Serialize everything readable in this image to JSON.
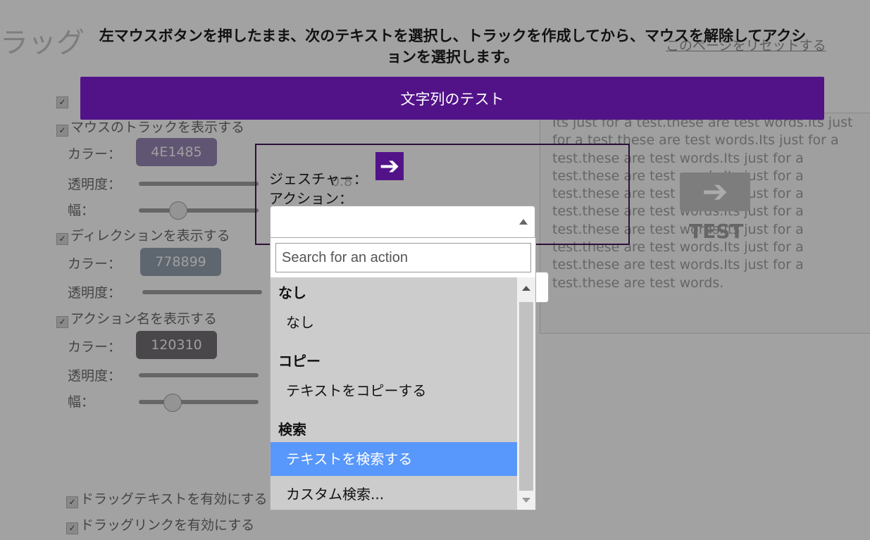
{
  "page": {
    "title_partial": "ラッグ",
    "reset_link": "このページをリセットする"
  },
  "settings": {
    "show_track": "マウスのトラックを表示する",
    "show_direction": "ディレクションを表示する",
    "show_action_name": "アクション名を表示する",
    "enable_drag_text": "ドラッグテキストを有効にする",
    "enable_drag_link": "ドラッグリンクを有効にする",
    "color_label": "カラー：",
    "opacity_label": "透明度：",
    "width_label": "幅：",
    "track_color": "4E1485",
    "direction_color": "778899",
    "action_color": "120310",
    "track_opacity": "0.8"
  },
  "instructions": "左マウスボタンを押したまま、次のテキストを選択し、トラックを作成してから、マウスを解除してアクションを選択します。",
  "test_bar_label": "文字列のテスト",
  "test_area": {
    "text": "Its just for a test.these are test words.Its just for a test.these are test words.Its just for a test.these are test words.Its just for a test.these are test words.Its just for a test.these are test words.Its just for a test.these are test words.Its just for a test.these are test words.Its just for a test.these are test words.Its just for a test.these are test words.Its just for a test.these are test words.",
    "label": "TEST"
  },
  "popup": {
    "gesture_label": "ジェスチャー：",
    "action_label": "アクション："
  },
  "dropdown": {
    "search_placeholder": "Search for an action",
    "groups": [
      {
        "label": "なし",
        "options": [
          "なし"
        ]
      },
      {
        "label": "コピー",
        "options": [
          "テキストをコピーする"
        ]
      },
      {
        "label": "検索",
        "options": [
          "テキストを検索する",
          "カスタム検索..."
        ]
      }
    ],
    "highlighted_option": "テキストを検索する"
  },
  "colors": {
    "accent": "#521389",
    "highlight": "#5897fb"
  }
}
